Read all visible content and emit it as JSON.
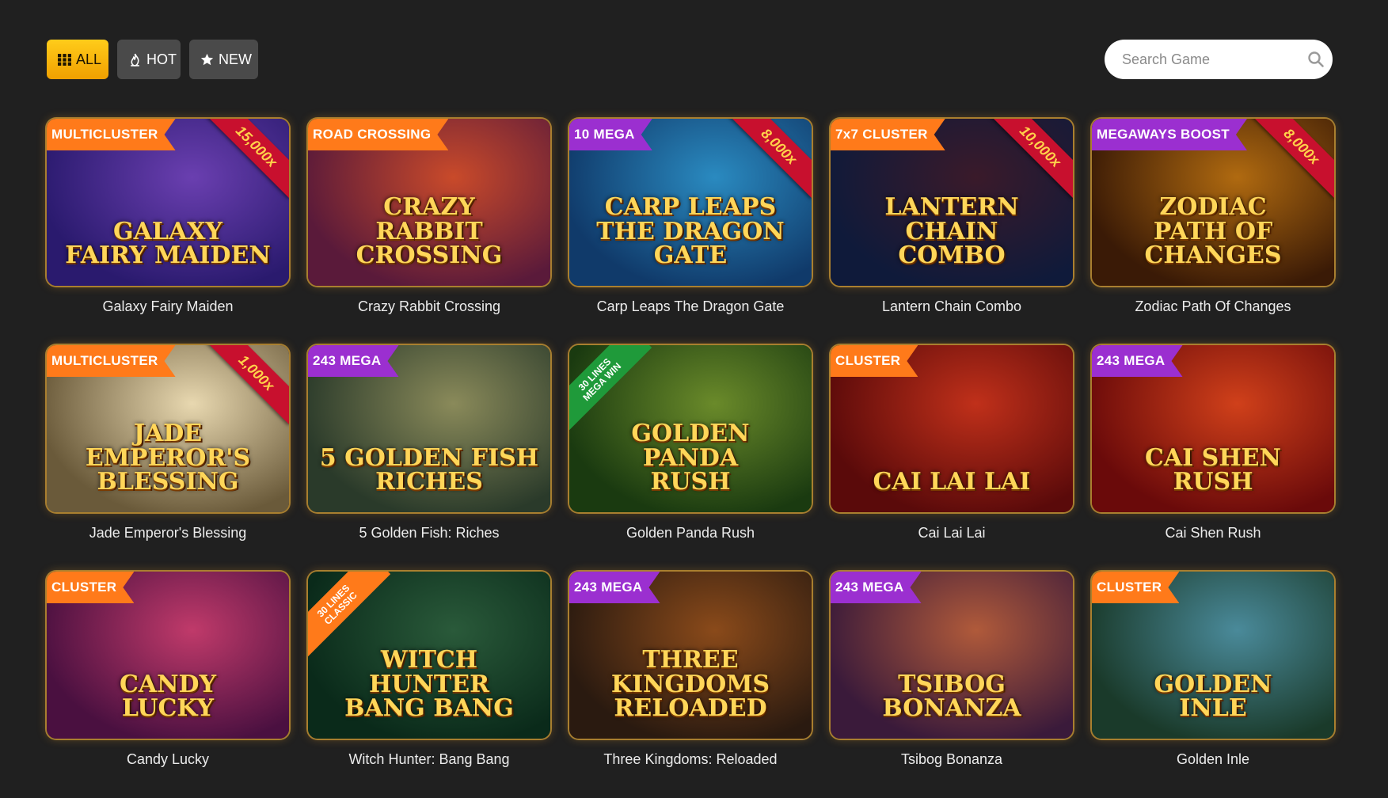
{
  "filters": [
    {
      "label": "ALL",
      "icon": "grid-icon",
      "active": true
    },
    {
      "label": "HOT",
      "icon": "flame-icon",
      "active": false
    },
    {
      "label": "NEW",
      "icon": "star-icon",
      "active": false
    }
  ],
  "search": {
    "placeholder": "Search Game",
    "icon": "search-icon"
  },
  "games": [
    {
      "title": "Galaxy Fairy Maiden",
      "badge": "MULTICLUSTER",
      "badge_color": "orange",
      "ribbon": "15,000x",
      "art": "GALAXY\nFAIRY MAIDEN",
      "bg": [
        "#2a1a6e",
        "#6a3fb0"
      ]
    },
    {
      "title": "Crazy Rabbit Crossing",
      "badge": "ROAD CROSSING",
      "badge_color": "orange",
      "ribbon": "",
      "art": "CRAZY\nRABBIT\nCROSSING",
      "bg": [
        "#5a1a3a",
        "#c94a2a"
      ]
    },
    {
      "title": "Carp Leaps The Dragon Gate",
      "badge": "10 MEGA",
      "badge_color": "purple",
      "ribbon": "8,000x",
      "art": "CARP LEAPS\nTHE DRAGON GATE",
      "bg": [
        "#103a6a",
        "#2a8ac0"
      ]
    },
    {
      "title": "Lantern Chain Combo",
      "badge": "7x7 CLUSTER",
      "badge_color": "orange",
      "ribbon": "10,000x",
      "art": "LANTERN\nCHAIN\nCOMBO",
      "bg": [
        "#0f1a3a",
        "#3a1a2a"
      ]
    },
    {
      "title": "Zodiac Path Of Changes",
      "badge": "MEGAWAYS BOOST",
      "badge_color": "purple",
      "ribbon": "8,000x",
      "art": "ZODIAC\nPATH OF CHANGES",
      "bg": [
        "#3a1a06",
        "#b06a10"
      ]
    },
    {
      "title": "Jade Emperor's Blessing",
      "badge": "MULTICLUSTER",
      "badge_color": "orange",
      "ribbon": "1,000x",
      "art": "JADE EMPEROR'S\nBLESSING",
      "bg": [
        "#6a5a3a",
        "#e8d8b0"
      ]
    },
    {
      "title": "5 Golden Fish: Riches",
      "badge": "243 MEGA",
      "badge_color": "purple",
      "ribbon": "",
      "art": "5 GOLDEN FISH\nRICHES",
      "bg": [
        "#2a3a2a",
        "#8a8a5a"
      ]
    },
    {
      "title": "Golden Panda Rush",
      "badge": "",
      "badge_color": "",
      "ribbon": "",
      "diag": "30 LINES\nMEGA WIN",
      "diag_color": "green",
      "art": "GOLDEN\nPANDA\nRUSH",
      "bg": [
        "#1a3a10",
        "#6a8a2a"
      ]
    },
    {
      "title": "Cai Lai Lai",
      "badge": "CLUSTER",
      "badge_color": "orange",
      "ribbon": "",
      "art": "CAI LAI LAI",
      "bg": [
        "#5a0a0a",
        "#c0301a"
      ]
    },
    {
      "title": "Cai Shen Rush",
      "badge": "243 MEGA",
      "badge_color": "purple",
      "ribbon": "",
      "art": "CAI SHEN\nRUSH",
      "bg": [
        "#6a0a0a",
        "#d0401a"
      ]
    },
    {
      "title": "Candy Lucky",
      "badge": "CLUSTER",
      "badge_color": "orange",
      "ribbon": "",
      "art": "CANDY\nLUCKY",
      "bg": [
        "#4a1040",
        "#c03a6a"
      ]
    },
    {
      "title": "Witch Hunter: Bang Bang",
      "badge": "",
      "badge_color": "",
      "ribbon": "",
      "diag": "30 LINES\nCLASSIC",
      "diag_color": "orange",
      "art": "WITCH\nHUNTER\nBANG BANG",
      "bg": [
        "#0a2a1a",
        "#2a5a3a"
      ]
    },
    {
      "title": "Three Kingdoms: Reloaded",
      "badge": "243 MEGA",
      "badge_color": "purple",
      "ribbon": "",
      "art": "THREE\nKINGDOMS\nRELOADED",
      "bg": [
        "#2a1a10",
        "#8a4a1a"
      ]
    },
    {
      "title": "Tsibog Bonanza",
      "badge": "243 MEGA",
      "badge_color": "purple",
      "ribbon": "",
      "art": "TSIBOG\nBONANZA",
      "bg": [
        "#3a1a3a",
        "#b05a3a"
      ]
    },
    {
      "title": "Golden Inle",
      "badge": "CLUSTER",
      "badge_color": "orange",
      "ribbon": "",
      "art": "GOLDEN\nINLE",
      "bg": [
        "#1a3a2a",
        "#4a8a9a"
      ]
    }
  ]
}
